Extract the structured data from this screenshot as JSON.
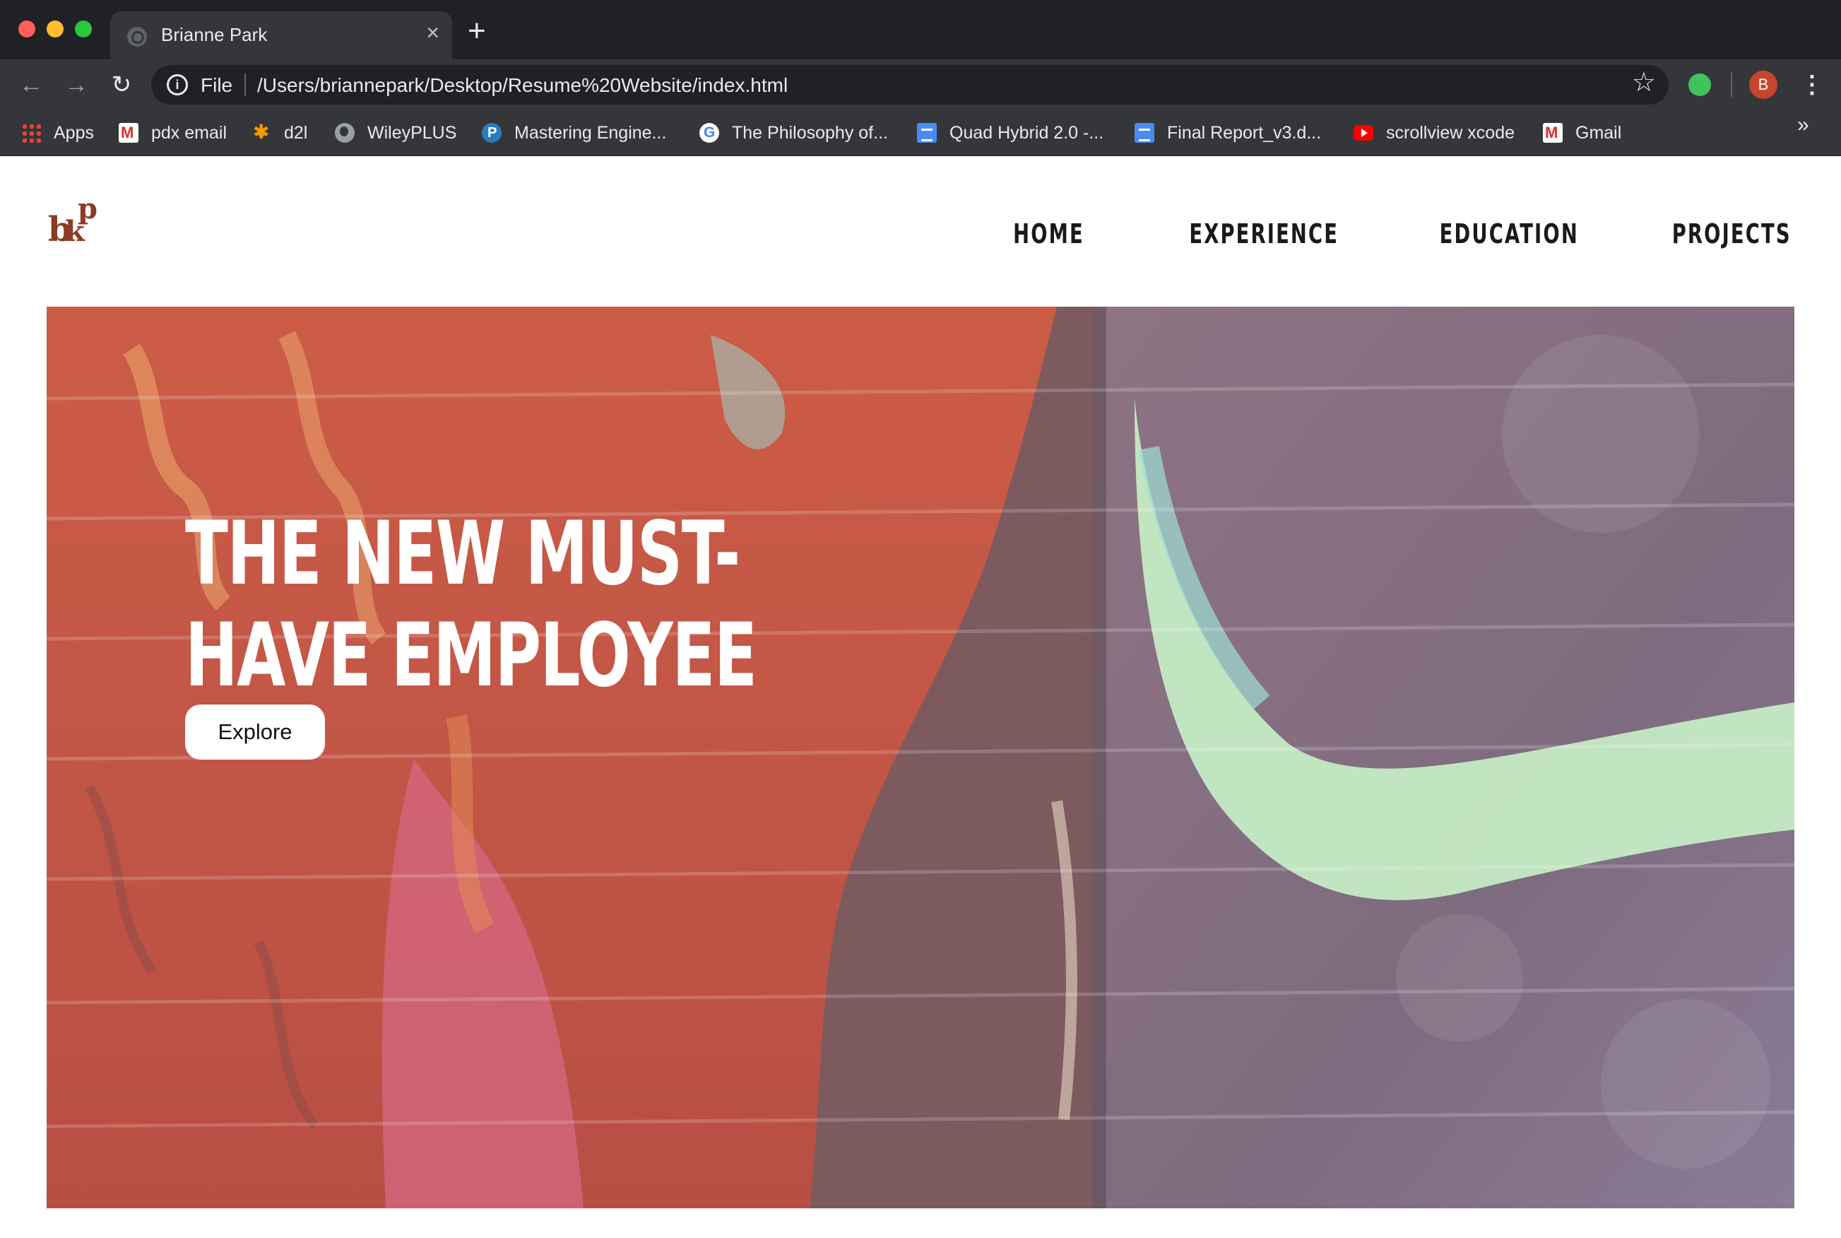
{
  "browser": {
    "tab_title": "Brianne Park",
    "close_glyph": "×",
    "new_tab_glyph": "+",
    "scheme_label": "File",
    "url": "/Users/briannepark/Desktop/Resume%20Website/index.html",
    "profile_initial": "B",
    "more_bookmarks_glyph": "»",
    "icons": {
      "back": "arrow-left-icon",
      "forward": "arrow-right-icon",
      "reload": "reload-icon",
      "info": "info-icon",
      "star": "star-icon",
      "extension": "extension-icon",
      "menu": "kebab-menu-icon"
    }
  },
  "bookmarks": [
    {
      "label": "Apps",
      "icon": "apps-grid-icon"
    },
    {
      "label": "pdx email",
      "icon": "gmail-icon"
    },
    {
      "label": "d2l",
      "icon": "d2l-icon"
    },
    {
      "label": "WileyPLUS",
      "icon": "globe-icon"
    },
    {
      "label": "Mastering Engine...",
      "icon": "pearson-icon"
    },
    {
      "label": "The Philosophy of...",
      "icon": "google-icon"
    },
    {
      "label": "Quad Hybrid 2.0 -...",
      "icon": "google-docs-icon"
    },
    {
      "label": "Final Report_v3.d...",
      "icon": "google-docs-icon"
    },
    {
      "label": "scrollview xcode",
      "icon": "youtube-icon"
    },
    {
      "label": "Gmail",
      "icon": "gmail-icon"
    }
  ],
  "site": {
    "logo_text": "bkp",
    "nav": [
      "HOME",
      "EXPERIENCE",
      "EDUCATION",
      "PROJECTS"
    ],
    "hero": {
      "title_line1": "THE NEW MUST-",
      "title_line2": "HAVE EMPLOYEE",
      "button_label": "Explore"
    }
  },
  "colors": {
    "logo_brown": "#8a3d24",
    "hero_red": "#c65a45",
    "hero_purple": "#8d7585",
    "hero_mint": "#c8f4c8"
  }
}
